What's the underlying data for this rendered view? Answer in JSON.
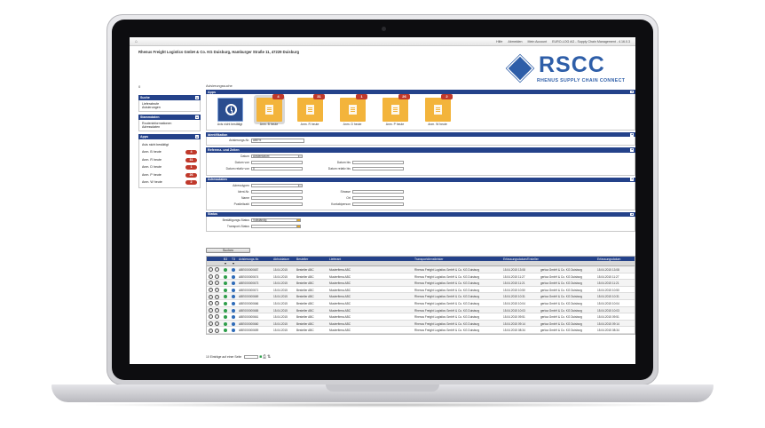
{
  "topbar": {
    "links": [
      "Hilfe",
      "Abmelden",
      "Mein Account",
      "EURO-LOG AG - Supply Chain Management - 4.16.0.3"
    ]
  },
  "header": {
    "company": "Rhenus Freight Logistics GmbH & Co. KG Duisburg, Hamburger Straße 11, 47229 Duisburg",
    "logo_word": "RSCC",
    "logo_sub": "RHENUS SUPPLY CHAIN CONNECT",
    "crumb": "0"
  },
  "sidebar": {
    "search_title": "Suche",
    "search_items": [
      "Lieferabrufe",
      "Avisierungen"
    ],
    "master_title": "Stammdaten",
    "master_items": [
      "Routeninformationen",
      "Adressdaten"
    ],
    "apps_title": "Apps",
    "apps_items": [
      {
        "label": "Avis nicht bestätigt",
        "count": ""
      },
      {
        "label": "Anm. B heute",
        "count": "4"
      },
      {
        "label": "Anm. R heute",
        "count": "31"
      },
      {
        "label": "Anm. D heute",
        "count": "1"
      },
      {
        "label": "Anm. P heute",
        "count": "26"
      },
      {
        "label": "Anm. W heute",
        "count": "2"
      }
    ]
  },
  "main": {
    "title": "Avisierungssuche",
    "apps_title": "Apps",
    "tiles": [
      {
        "label": "Avis nicht bestätigt",
        "count": ""
      },
      {
        "label": "Anm. B heute",
        "count": "4"
      },
      {
        "label": "Anm. R heute",
        "count": "31"
      },
      {
        "label": "Anm. D heute",
        "count": "1"
      },
      {
        "label": "Anm. P heute",
        "count": "26"
      },
      {
        "label": "Anm. W heute",
        "count": "2"
      }
    ],
    "ident_title": "Identifikation",
    "ident_label": "Avisierungs-Nr.",
    "ident_value": "ABE%",
    "ref_title": "Referenz- und Zeiten",
    "ref_datum_label": "Datum",
    "ref_datum_value": "Avisierdatum",
    "ref_von": "Datum von",
    "ref_bis": "Datum bis",
    "ref_relvon": "Datum relativ von",
    "ref_relvon_value": "0",
    "ref_relbis": "Datum relativ bis",
    "addr_title": "Adressdaten",
    "addr_typ": "Adresstypen",
    "addr_nr": "Ident-Nr.",
    "addr_name": "Name",
    "addr_plz": "Postleitzahl",
    "addr_strasse": "Strasse",
    "addr_ort": "Ort",
    "addr_kontakt": "Kontaktperson",
    "status_title": "Status",
    "status_best": "Bestätigungs-Status",
    "status_best_value": "Vollständig",
    "status_trans": "Transport-Status",
    "search_button": "Suchen"
  },
  "table": {
    "headers": [
      "B3",
      "T3",
      "Avisierungs-Nr.",
      "Abholdatum",
      "Besteller",
      "Lieferant",
      "Transportdienstleister",
      "Erfassungsdatum/Ersteller",
      "Erfassungsdatum"
    ],
    "rows": [
      [
        "ABE000000687",
        "15.04.2015",
        "Besteller ABC",
        "Musterfirma ABC",
        "Rhenus Freight Logistics GmbH & Co. KG Duisburg",
        "15.04.2015 13:08",
        "gerloa GmbH & Co. KG Duisburg",
        "15.04.2015 13:08"
      ],
      [
        "ABE000000674",
        "15.04.2015",
        "Besteller ABC",
        "Musterfirma ABC",
        "Rhenus Freight Logistics GmbH & Co. KG Duisburg",
        "15.04.2015 11:27",
        "gerloa GmbH & Co. KG Duisburg",
        "15.04.2015 11:27"
      ],
      [
        "ABE000000673",
        "15.04.2015",
        "Besteller ABC",
        "Musterfirma ABC",
        "Rhenus Freight Logistics GmbH & Co. KG Duisburg",
        "15.04.2015 11:21",
        "gerloa GmbH & Co. KG Duisburg",
        "15.04.2015 11:21"
      ],
      [
        "ABE000000671",
        "15.04.2015",
        "Besteller ABC",
        "Musterfirma ABC",
        "Rhenus Freight Logistics GmbH & Co. KG Duisburg",
        "15.04.2015 10:50",
        "gerloa GmbH & Co. KG Duisburg",
        "15.04.2015 10:50"
      ],
      [
        "ABE000000669",
        "15.04.2015",
        "Besteller ABC",
        "Musterfirma ABC",
        "Rhenus Freight Logistics GmbH & Co. KG Duisburg",
        "15.04.2015 10:31",
        "gerloa GmbH & Co. KG Duisburg",
        "15.04.2015 10:31"
      ],
      [
        "ABE000000666",
        "15.04.2015",
        "Besteller ABC",
        "Musterfirma ABC",
        "Rhenus Freight Logistics GmbH & Co. KG Duisburg",
        "15.04.2015 10:04",
        "gerloa GmbH & Co. KG Duisburg",
        "15.04.2015 10:04"
      ],
      [
        "ABE000000665",
        "15.04.2015",
        "Besteller ABC",
        "Musterfirma ABC",
        "Rhenus Freight Logistics GmbH & Co. KG Duisburg",
        "15.04.2015 10:03",
        "gerloa GmbH & Co. KG Duisburg",
        "15.04.2015 10:03"
      ],
      [
        "ABE000000661",
        "15.04.2015",
        "Besteller ABC",
        "Musterfirma ABC",
        "Rhenus Freight Logistics GmbH & Co. KG Duisburg",
        "15.04.2015 09:51",
        "gerloa GmbH & Co. KG Duisburg",
        "15.04.2015 09:51"
      ],
      [
        "ABE000000660",
        "15.04.2015",
        "Besteller ABC",
        "Musterfirma ABC",
        "Rhenus Freight Logistics GmbH & Co. KG Duisburg",
        "15.04.2015 09:14",
        "gerloa GmbH & Co. KG Duisburg",
        "15.04.2015 09:14"
      ],
      [
        "ABE000000659",
        "15.04.2015",
        "Besteller ABC",
        "Musterfirma ABC",
        "Rhenus Freight Logistics GmbH & Co. KG Duisburg",
        "15.04.2015 08:34",
        "gerloa GmbH & Co. KG Duisburg",
        "15.04.2015 08:34"
      ]
    ],
    "footer": "10 Einträge auf einer Seite"
  }
}
